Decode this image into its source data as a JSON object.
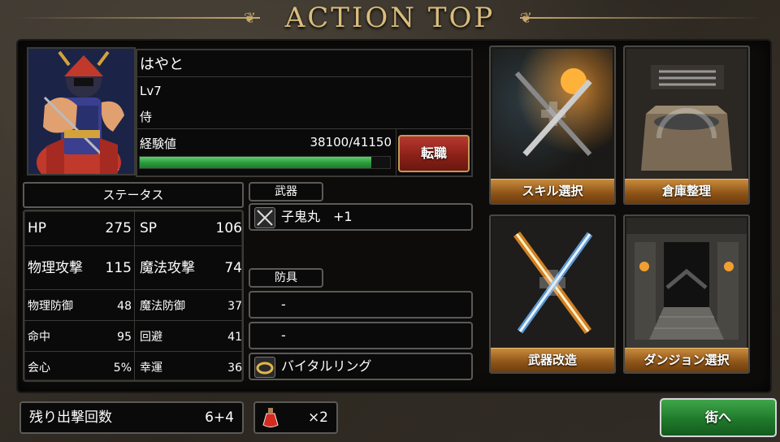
{
  "header": {
    "title": "ACTION TOP"
  },
  "character": {
    "name": "はやと",
    "level": "Lv7",
    "job": "侍",
    "exp_label": "経験値",
    "exp_value": "38100/41150",
    "exp_progress": 0.926,
    "job_change_label": "転職"
  },
  "status": {
    "header": "ステータス",
    "rows": [
      {
        "label": "HP",
        "value": "275",
        "label2": "SP",
        "value2": "106"
      },
      {
        "label": "物理攻撃",
        "value": "115",
        "label2": "魔法攻撃",
        "value2": "74"
      },
      {
        "label": "物理防御",
        "value": "48",
        "label2": "魔法防御",
        "value2": "37"
      },
      {
        "label": "命中",
        "value": "95",
        "label2": "回避",
        "value2": "41"
      },
      {
        "label": "会心",
        "value": "5%",
        "label2": "幸運",
        "value2": "36"
      }
    ]
  },
  "equipment": {
    "weapon_tab": "武器",
    "weapon": "子鬼丸　+1",
    "armor_tab": "防具",
    "armor": [
      "-",
      "-",
      "バイタルリング"
    ]
  },
  "menu": [
    {
      "label": "スキル選択",
      "icon": "skill-icon"
    },
    {
      "label": "倉庫整理",
      "icon": "storage-icon"
    },
    {
      "label": "武器改造",
      "icon": "weapon-upgrade-icon"
    },
    {
      "label": "ダンジョン選択",
      "icon": "dungeon-icon"
    }
  ],
  "footer": {
    "sorties_label": "残り出撃回数",
    "sorties_value": "6+4",
    "potion_count": "×2",
    "town_button": "街へ"
  },
  "colors": {
    "accent_gold": "#d9bd7b",
    "exp_green": "#2e9c3e",
    "button_red": "#8b2119",
    "button_green": "#1f7a2b"
  }
}
